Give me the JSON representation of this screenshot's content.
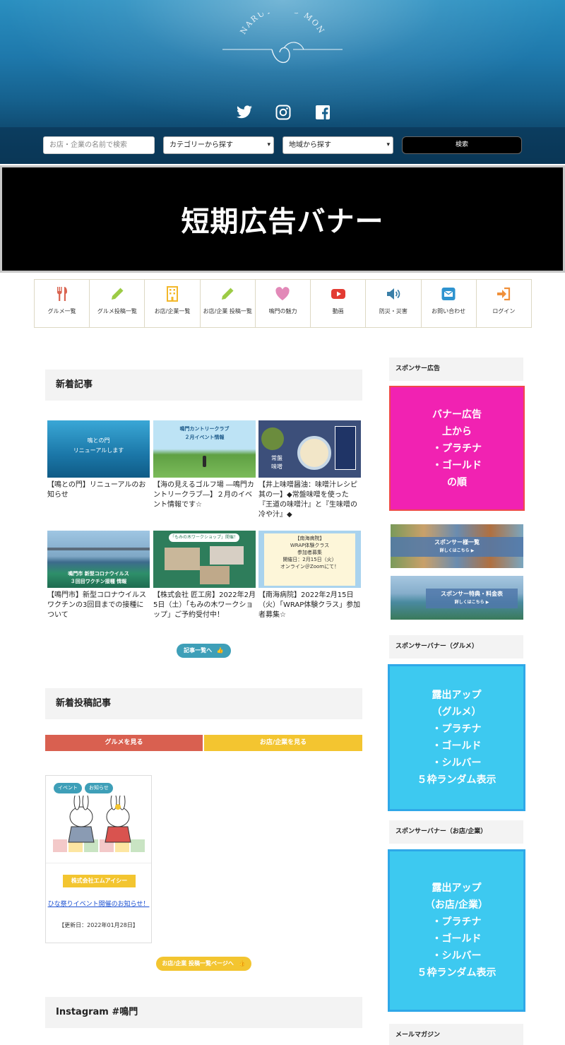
{
  "header": {
    "logo_text": "NARUTO NO MON",
    "social_icons": [
      "twitter-icon",
      "instagram-icon",
      "facebook-icon"
    ],
    "search": {
      "placeholder": "お店・企業の名前で検索",
      "category_select": "カテゴリーから探す",
      "area_select": "地域から探す",
      "button_label": "検索"
    }
  },
  "ad_banner": {
    "text": "短期広告バナー"
  },
  "nav": [
    {
      "label": "グルメ一覧",
      "icon": "fork-knife-icon",
      "color": "#d9634f"
    },
    {
      "label": "グルメ投稿一覧",
      "icon": "pencil-icon",
      "color": "#9ccb45"
    },
    {
      "label": "お店/企業一覧",
      "icon": "building-icon",
      "color": "#f3b82a"
    },
    {
      "label": "お店/企業 投稿一覧",
      "icon": "pencil-icon",
      "color": "#9ccb45"
    },
    {
      "label": "鳴門の魅力",
      "icon": "heart-icon",
      "color": "#e289b8"
    },
    {
      "label": "動画",
      "icon": "youtube-icon",
      "color": "#e33b32"
    },
    {
      "label": "防災・災害",
      "icon": "speaker-icon",
      "color": "#3a7fa8"
    },
    {
      "label": "お問い合わせ",
      "icon": "mail-icon",
      "color": "#2e93cf"
    },
    {
      "label": "ログイン",
      "icon": "login-icon",
      "color": "#f0903a"
    }
  ],
  "main": {
    "new_articles": {
      "heading": "新着記事",
      "posts": [
        {
          "title": "【鳴との門】リニューアルのお知らせ",
          "thumb_text": "鳴との門\nリニューアルします"
        },
        {
          "title": "【海の見えるゴルフ場 ―鳴門カントリークラブ―】２月のイベント情報です☆",
          "thumb_text": "鳴門カントリークラブ\n２月イベント情報"
        },
        {
          "title": "【井上味噌醤油：味噌汁レシピ其の一】◆常盤味噌を使った『王道の味噌汁』と『生味噌の冷や汁』◆",
          "thumb_text": "常盤\n味噌"
        },
        {
          "title": "【鳴門市】新型コロナウイルスワクチンの3回目までの接種について",
          "thumb_text": "鳴門市 新型コロナウイルス\n３回目ワクチン接種 情報"
        },
        {
          "title": "【株式会社 匠工房】2022年2月5日（土）「もみの木ワークショップ」ご予約受付中！",
          "thumb_text": "「もみの木ワークショップ」開催！"
        },
        {
          "title": "【南海病院】2022年2月15日（火）「WRAP体験クラス」参加者募集☆",
          "thumb_text": "【南海病院】\nWRAP体験クラス\n参加者募集\n開催日：2月15日（火）\nオンライン＠Zoomにて！"
        }
      ],
      "more_button": "記事一覧へ"
    },
    "new_posts": {
      "heading": "新着投稿記事",
      "tab_gourmet": "グルメを見る",
      "tab_shop": "お店/企業を見る",
      "card": {
        "tag1": "イベント",
        "tag2": "お知らせ",
        "company": "株式会社エムアイシー",
        "title": "ひな祭りイベント開催のお知らせ！",
        "updated": "【更新日：2022年01月28日】"
      },
      "more_button": "お店/企業 投稿一覧ページへ"
    },
    "instagram": {
      "heading": "Instagram #鳴門"
    }
  },
  "sidebar": {
    "sponsor_ad": {
      "heading": "スポンサー広告",
      "box_lines": [
        "バナー広告",
        "上から",
        "・プラチナ",
        "・ゴールド",
        "の順"
      ],
      "box_color": "#f122b2"
    },
    "sponsor_list_banner": {
      "line1": "スポンサー様一覧",
      "line2": "詳しくはこちら ▶"
    },
    "sponsor_price_banner": {
      "line1": "スポンサー特典・料金表",
      "line2": "詳しくはこちら ▶"
    },
    "gourmet": {
      "heading": "スポンサーバナー（グルメ）",
      "box_lines": [
        "露出アップ",
        "（グルメ）",
        "・プラチナ",
        "・ゴールド",
        "・シルバー",
        "５枠ランダム表示"
      ],
      "box_color": "#3dc9f0"
    },
    "shop": {
      "heading": "スポンサーバナー（お店/企業）",
      "box_lines": [
        "露出アップ",
        "（お店/企業）",
        "・プラチナ",
        "・ゴールド",
        "・シルバー",
        "５枠ランダム表示"
      ],
      "box_color": "#3dc9f0"
    },
    "mail": {
      "heading": "メールマガジン"
    }
  }
}
